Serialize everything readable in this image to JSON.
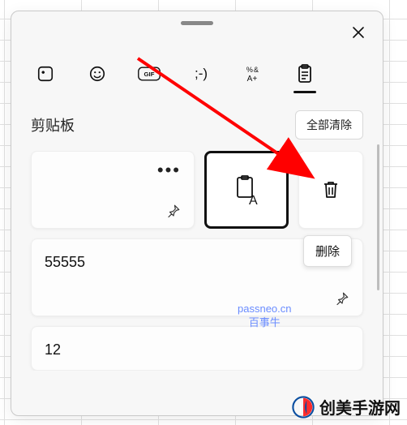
{
  "panel": {
    "title": "剪贴板",
    "clear_all_label": "全部清除",
    "tabs": [
      {
        "name": "sticker"
      },
      {
        "name": "emoji"
      },
      {
        "name": "gif",
        "label": "GIF"
      },
      {
        "name": "kaomoji",
        "label": ";-)"
      },
      {
        "name": "symbols"
      },
      {
        "name": "clipboard",
        "active": true
      }
    ]
  },
  "clipboard": {
    "items": [
      {
        "kind": "text",
        "value": ""
      },
      {
        "kind": "text",
        "value": "55555"
      },
      {
        "kind": "text",
        "value": "12"
      }
    ],
    "delete_tooltip": "删除"
  },
  "watermark": {
    "line1": "passneo.cn",
    "line2": "百事牛"
  },
  "footer": {
    "brand": "创美手游网"
  }
}
